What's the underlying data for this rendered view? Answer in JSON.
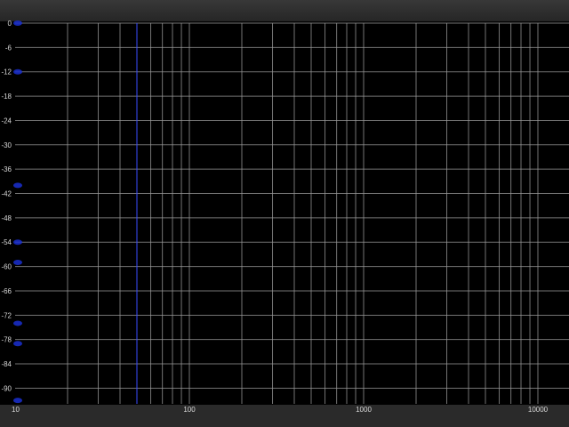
{
  "chart_data": {
    "type": "line",
    "title": "",
    "xlabel": "",
    "ylabel": "",
    "x_scale": "log",
    "xlim": [
      10,
      15000
    ],
    "ylim": [
      -96,
      0
    ],
    "grid": true,
    "x_major_ticks": [
      10,
      100,
      1000,
      10000
    ],
    "x_tick_labels": [
      "10",
      "100",
      "1000",
      "10000"
    ],
    "x_minor_ticks": [
      20,
      30,
      40,
      50,
      60,
      70,
      80,
      90,
      200,
      300,
      400,
      500,
      600,
      700,
      800,
      900,
      2000,
      3000,
      4000,
      5000,
      6000,
      7000,
      8000,
      9000
    ],
    "y_ticks": [
      0,
      -6,
      -12,
      -18,
      -24,
      -30,
      -36,
      -42,
      -48,
      -54,
      -60,
      -66,
      -72,
      -78,
      -84,
      -90
    ],
    "y_tick_labels": [
      "0",
      "-6",
      "-12",
      "-18",
      "-24",
      "-30",
      "-36",
      "-42",
      "-48",
      "-54",
      "-60",
      "-66",
      "-72",
      "-78",
      "-84",
      "-90"
    ],
    "series": [
      {
        "x": [
          10,
          10,
          10,
          10,
          10,
          10,
          10,
          10
        ],
        "y": [
          0,
          -12,
          -40,
          -54,
          -59,
          -74,
          -79,
          -93
        ]
      }
    ],
    "marker_line_x": 50,
    "colors": {
      "background": "#000000",
      "grid": "#9a9a9a",
      "series": "#1a2fd0",
      "marker_line": "#3a4cff",
      "tick_text": "#d8d8d8"
    }
  }
}
